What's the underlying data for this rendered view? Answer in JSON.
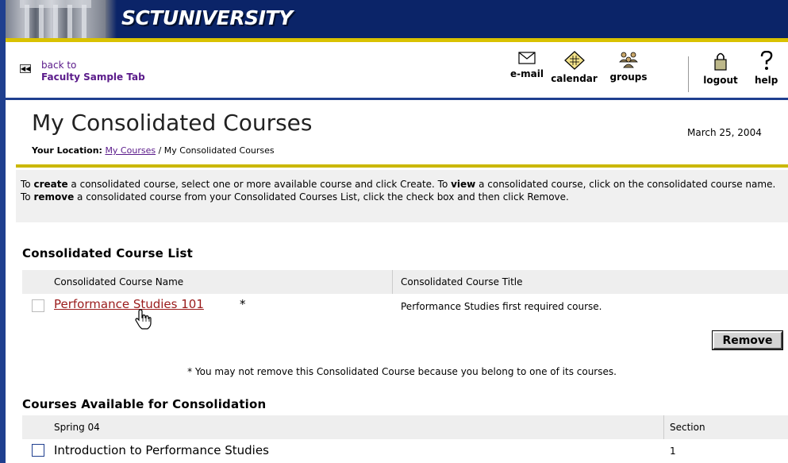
{
  "banner": {
    "title": "SCTUNIVERSITY"
  },
  "back": {
    "prefix": "back to",
    "target": "Faculty Sample Tab"
  },
  "toolbar": {
    "email": "e-mail",
    "calendar": "calendar",
    "groups": "groups",
    "logout": "logout",
    "help": "help"
  },
  "page": {
    "title": "My Consolidated Courses",
    "date": "March 25, 2004",
    "location_label": "Your Location:",
    "location_link": "My Courses",
    "location_current": " / My Consolidated Courses"
  },
  "instructions": {
    "p1": "To ",
    "create": "create",
    "p2": " a consolidated course, select one or more available course and click Create. To ",
    "view": "view",
    "p3": " a consolidated course, click on the consolidated course name. To ",
    "remove": "remove",
    "p4": " a consolidated course from your Consolidated Courses List, click the check box and then click Remove."
  },
  "consolidated": {
    "section_title": "Consolidated Course List",
    "col_name": "Consolidated Course Name",
    "col_title": "Consolidated Course Title",
    "rows": [
      {
        "name": "Performance Studies 101",
        "marker": "*",
        "title": "Performance Studies first required course."
      }
    ],
    "remove_label": "Remove",
    "footnote": "* You may not remove this Consolidated Course because you belong to one of its courses."
  },
  "available": {
    "section_title": "Courses Available for Consolidation",
    "col_term": "Spring 04",
    "col_section": "Section",
    "rows": [
      {
        "name": "Introduction to Performance Studies",
        "section": "1"
      }
    ]
  }
}
